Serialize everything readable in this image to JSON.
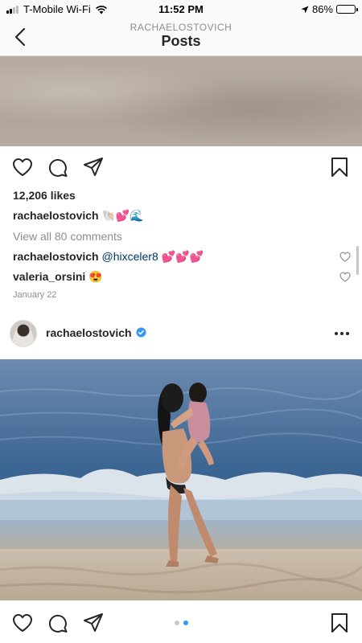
{
  "status_bar": {
    "carrier": "T-Mobile Wi-Fi",
    "time": "11:52 PM",
    "battery": "86%",
    "battery_level": 0.86
  },
  "nav": {
    "subtitle": "RACHAELOSTOVICH",
    "title": "Posts",
    "back_icon": "chevron-left-icon"
  },
  "post1": {
    "likes": "12,206 likes",
    "caption": {
      "user": "rachaelostovich",
      "text": "🐚💕🌊"
    },
    "view_comments": "View all 80 comments",
    "comments": [
      {
        "user": "rachaelostovich",
        "mention": "@hixceler8",
        "text": "💕💕💕"
      },
      {
        "user": "valeria_orsini",
        "mention": "",
        "text": "😍"
      }
    ],
    "date": "January 22",
    "icons": [
      "heart-icon",
      "comment-icon",
      "share-icon",
      "bookmark-icon"
    ]
  },
  "post2": {
    "username": "rachaelostovich",
    "verified": true,
    "carousel": {
      "count": 2,
      "active": 2
    },
    "icons": [
      "heart-icon",
      "comment-icon",
      "share-icon",
      "bookmark-icon",
      "more-icon"
    ]
  },
  "colors": {
    "text": "#262626",
    "secondary": "#8e8e8e",
    "link": "#00376b",
    "verified": "#3897f0",
    "active_dot": "#3897f0"
  }
}
